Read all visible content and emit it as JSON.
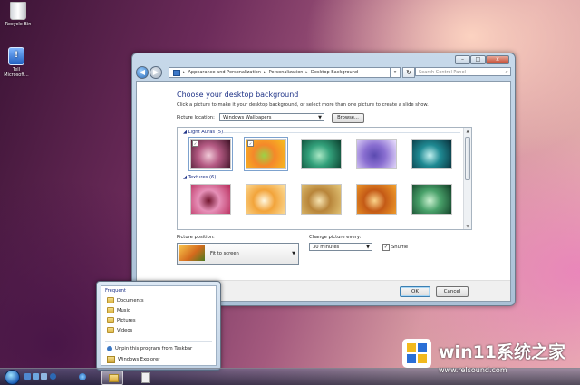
{
  "desktop": {
    "icons": [
      {
        "label": "Recycle Bin"
      },
      {
        "label": "Tell Microsoft..."
      }
    ]
  },
  "window": {
    "title_buttons": {
      "minimize": "–",
      "maximize": "□",
      "close": "x"
    },
    "nav": {
      "back": "◀",
      "forward": "▶"
    },
    "breadcrumb": [
      "Appearance and Personalization",
      "Personalization",
      "Desktop Background"
    ],
    "breadcrumb_separator": "▸",
    "search_placeholder": "Search Control Panel",
    "heading": "Choose your desktop background",
    "instruction": "Click a picture to make it your desktop background, or select more than one picture to create a slide show.",
    "picture_location_label": "Picture location:",
    "picture_location_value": "Windows Wallpapers",
    "browse_label": "Browse...",
    "groups": [
      {
        "name": "Light Auras (5)",
        "thumbs": [
          {
            "checked": true,
            "colors": [
              "#3a0f22",
              "#b55b84",
              "#f1cad8"
            ]
          },
          {
            "checked": true,
            "colors": [
              "#f7c11e",
              "#f5882a",
              "#9bd247"
            ]
          },
          {
            "checked": false,
            "colors": [
              "#0a3d2c",
              "#33a17b",
              "#a8e7c4"
            ]
          },
          {
            "checked": false,
            "colors": [
              "#ede3ff",
              "#8a6fd1",
              "#5b4ab0"
            ]
          },
          {
            "checked": false,
            "colors": [
              "#082b36",
              "#1f8a93",
              "#c2f1f0"
            ]
          }
        ]
      },
      {
        "name": "Textures (6)",
        "thumbs": [
          {
            "checked": false,
            "colors": [
              "#b82c5b",
              "#e690b8",
              "#73162f"
            ]
          },
          {
            "checked": false,
            "colors": [
              "#fde1a0",
              "#f2a43b",
              "#fff8e0"
            ]
          },
          {
            "checked": false,
            "colors": [
              "#e4c779",
              "#b8853a",
              "#f6e3b0"
            ]
          },
          {
            "checked": false,
            "colors": [
              "#f2a02c",
              "#c45a16",
              "#fbd48a"
            ]
          },
          {
            "checked": false,
            "colors": [
              "#0f3a24",
              "#49a16a",
              "#c9f0cf"
            ]
          },
          {
            "checked": false,
            "colors": [
              "#4d8c1a",
              "#b8e06a",
              "#2d5a0e"
            ]
          }
        ]
      }
    ],
    "picture_position_label": "Picture position:",
    "picture_position_value": "Fit to screen",
    "change_every_label": "Change picture every:",
    "change_every_value": "30 minutes",
    "shuffle_label": "Shuffle",
    "shuffle_checked": true,
    "ok_label": "OK",
    "cancel_label": "Cancel"
  },
  "jump_list": {
    "section": "Frequent",
    "items": [
      "Documents",
      "Music",
      "Pictures",
      "Videos"
    ],
    "tasks": [
      "Unpin this program from Taskbar",
      "Windows Explorer"
    ]
  },
  "watermark": {
    "title": "win11系统之家",
    "url": "www.relsound.com"
  }
}
